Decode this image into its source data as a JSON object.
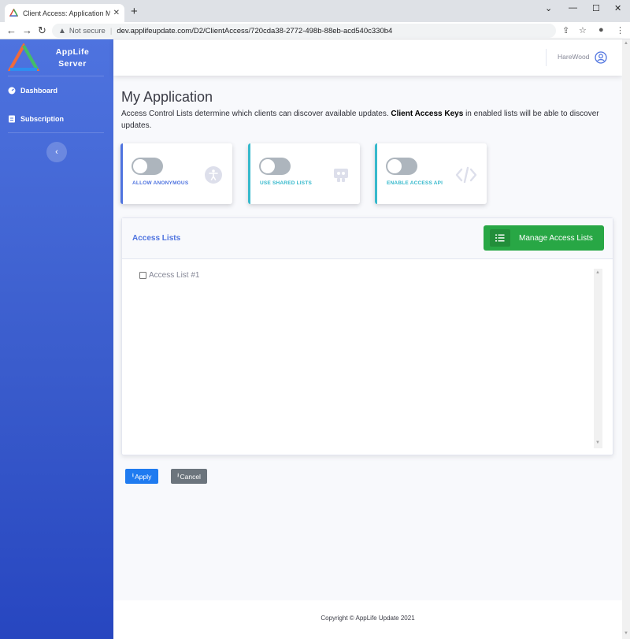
{
  "browser": {
    "tab_title": "Client Access: Application My Ap",
    "new_tab_symbol": "+",
    "security_label": "Not secure",
    "url": "dev.applifeupdate.com/D2/ClientAccess/720cda38-2772-498b-88eb-acd540c330b4"
  },
  "sidebar": {
    "brand_line1": "AppLife",
    "brand_line2": "Server",
    "items": [
      {
        "label": "Dashboard",
        "icon": "dashboard-icon"
      },
      {
        "label": "Subscription",
        "icon": "subscription-icon"
      }
    ],
    "toggle_symbol": "‹"
  },
  "topbar": {
    "user_name": "HareWood"
  },
  "page": {
    "title": "My Application",
    "description_part1": "Access Control Lists determine which clients can discover available updates. ",
    "description_bold": "Client Access Keys",
    "description_part2": " in enabled lists will be able to discover updates."
  },
  "cards": [
    {
      "label": "ALLOW ANONYMOUS",
      "enabled": false,
      "accent": "#4e73df",
      "icon": "accessibility-icon"
    },
    {
      "label": "USE SHARED LISTS",
      "enabled": false,
      "accent": "#36b9cc",
      "icon": "shared-lists-icon"
    },
    {
      "label": "ENABLE ACCESS API",
      "enabled": false,
      "accent": "#36b9cc",
      "icon": "code-icon"
    }
  ],
  "access_lists": {
    "title": "Access Lists",
    "manage_label": "Manage Access Lists",
    "items": [
      {
        "label": "Access List #1",
        "checked": false
      }
    ]
  },
  "actions": {
    "apply_label": "Apply",
    "cancel_label": "Cancel"
  },
  "footer": {
    "copyright": "Copyright © AppLife Update 2021"
  },
  "colors": {
    "primary": "#4e73df",
    "info": "#36b9cc",
    "success": "#28a745",
    "secondary": "#6c757d"
  }
}
